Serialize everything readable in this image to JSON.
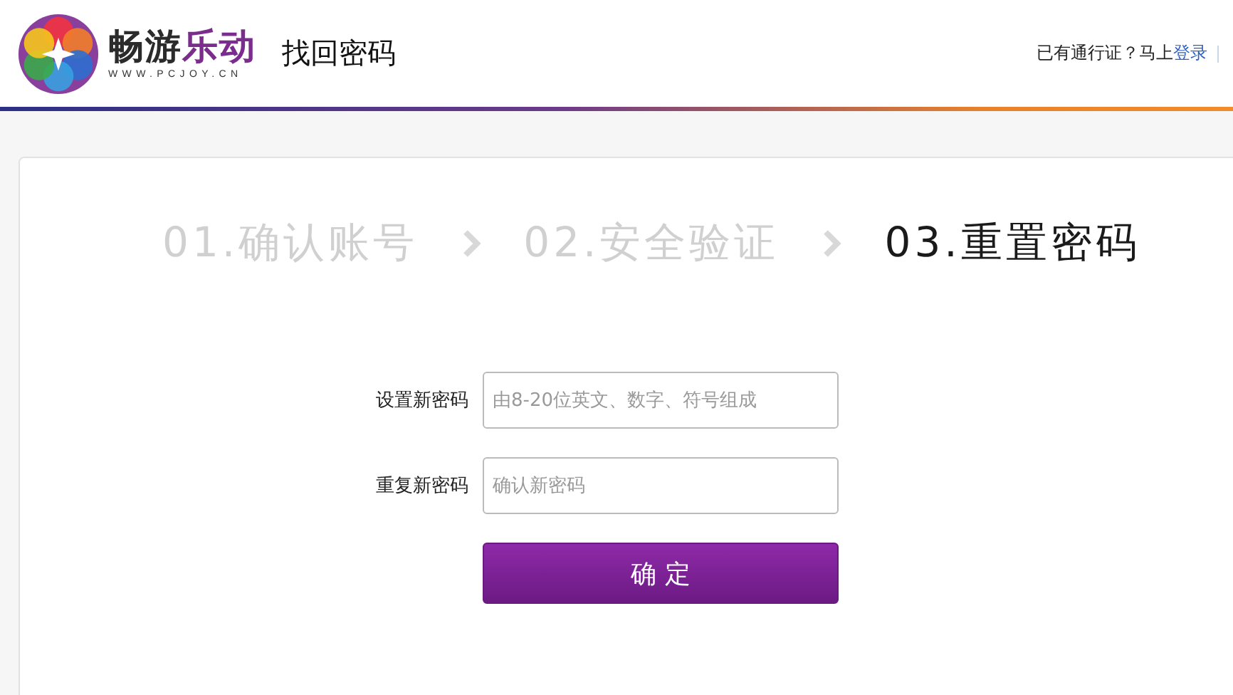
{
  "header": {
    "brand": {
      "parts": [
        {
          "text": "畅游",
          "color": "#2b2b2b"
        },
        {
          "text": "乐动",
          "color": "#7b2d8e"
        }
      ],
      "domain": "WWW.PCJOY.CN"
    },
    "page_title": "找回密码",
    "account_prompt": "已有通行证？马上",
    "login_link": "登录"
  },
  "steps": [
    {
      "label": "01.确认账号",
      "selected": false
    },
    {
      "label": "02.安全验证",
      "selected": false
    },
    {
      "label": "03.重置密码",
      "selected": true
    }
  ],
  "form": {
    "fields": [
      {
        "label": "设置新密码",
        "placeholder": "由8-20位英文、数字、符号组成"
      },
      {
        "label": "重复新密码",
        "placeholder": "确认新密码"
      }
    ],
    "submit": "确 定"
  }
}
